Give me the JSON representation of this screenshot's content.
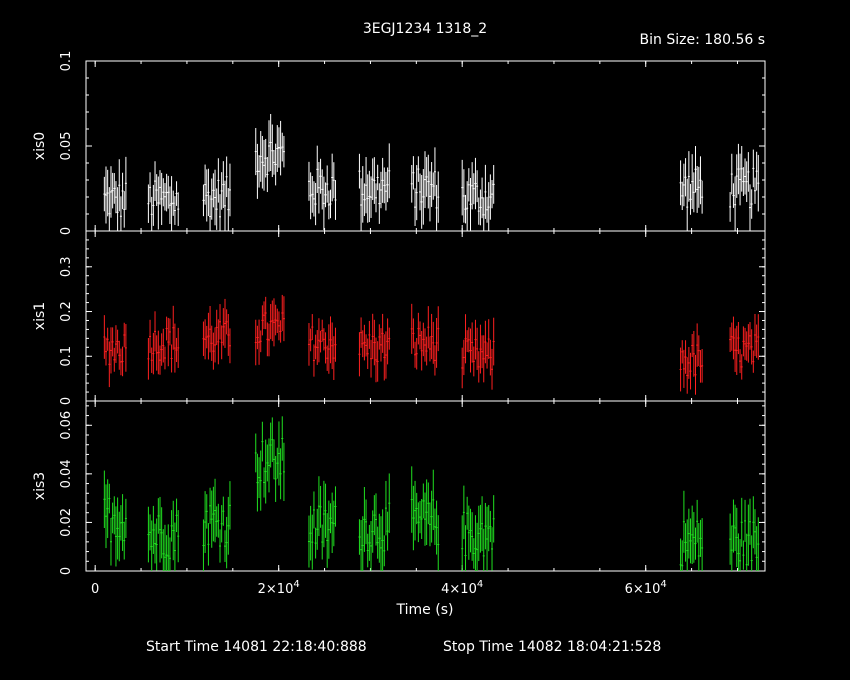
{
  "chart_data": {
    "type": "scatter",
    "title": "3EGJ1234 1318_2",
    "bin_size_label": "Bin Size: 180.56 s",
    "xlabel": "Time (s)",
    "xlim": [
      -1000,
      73000
    ],
    "x_ticks": [
      {
        "value": 0,
        "label": "0"
      },
      {
        "value": 20000,
        "label": "2×10",
        "exp": "4"
      },
      {
        "value": 40000,
        "label": "4×10",
        "exp": "4"
      },
      {
        "value": 60000,
        "label": "6×10",
        "exp": "4"
      }
    ],
    "start_time": "Start Time 14081 22:18:40:888",
    "stop_time": "Stop Time 14082 18:04:21:528",
    "segments": [
      [
        1000,
        3500
      ],
      [
        5800,
        9200
      ],
      [
        11800,
        14800
      ],
      [
        17500,
        20600
      ],
      [
        23300,
        26300
      ],
      [
        28800,
        32200
      ],
      [
        34500,
        37500
      ],
      [
        40000,
        43500
      ],
      [
        63800,
        66200
      ],
      [
        69200,
        72300
      ]
    ],
    "panels": [
      {
        "name": "xis0",
        "ylabel": "xis0",
        "color": "#ffffff",
        "ylim": [
          0,
          0.1
        ],
        "y_ticks": [
          {
            "value": 0,
            "label": "0"
          },
          {
            "value": 0.05,
            "label": "0.05"
          },
          {
            "value": 0.1,
            "label": "0.1"
          }
        ],
        "levels": [
          0.018,
          0.018,
          0.02,
          0.045,
          0.025,
          0.025,
          0.025,
          0.02,
          0.025,
          0.025
        ],
        "spread": 0.012
      },
      {
        "name": "xis1",
        "ylabel": "xis1",
        "color": "#ff2020",
        "ylim": [
          0,
          0.38
        ],
        "y_ticks": [
          {
            "value": 0,
            "label": "0"
          },
          {
            "value": 0.1,
            "label": "0.1"
          },
          {
            "value": 0.2,
            "label": "0.2"
          },
          {
            "value": 0.3,
            "label": "0.3"
          }
        ],
        "levels": [
          0.12,
          0.13,
          0.14,
          0.16,
          0.13,
          0.12,
          0.13,
          0.1,
          0.09,
          0.11
        ],
        "spread": 0.04
      },
      {
        "name": "xis3",
        "ylabel": "xis3",
        "color": "#20e020",
        "ylim": [
          0,
          0.07
        ],
        "y_ticks": [
          {
            "value": 0,
            "label": "0"
          },
          {
            "value": 0.02,
            "label": "0.02"
          },
          {
            "value": 0.04,
            "label": "0.04"
          },
          {
            "value": 0.06,
            "label": "0.06"
          }
        ],
        "levels": [
          0.022,
          0.015,
          0.02,
          0.045,
          0.018,
          0.018,
          0.02,
          0.015,
          0.012,
          0.012
        ],
        "spread": 0.01
      }
    ]
  }
}
